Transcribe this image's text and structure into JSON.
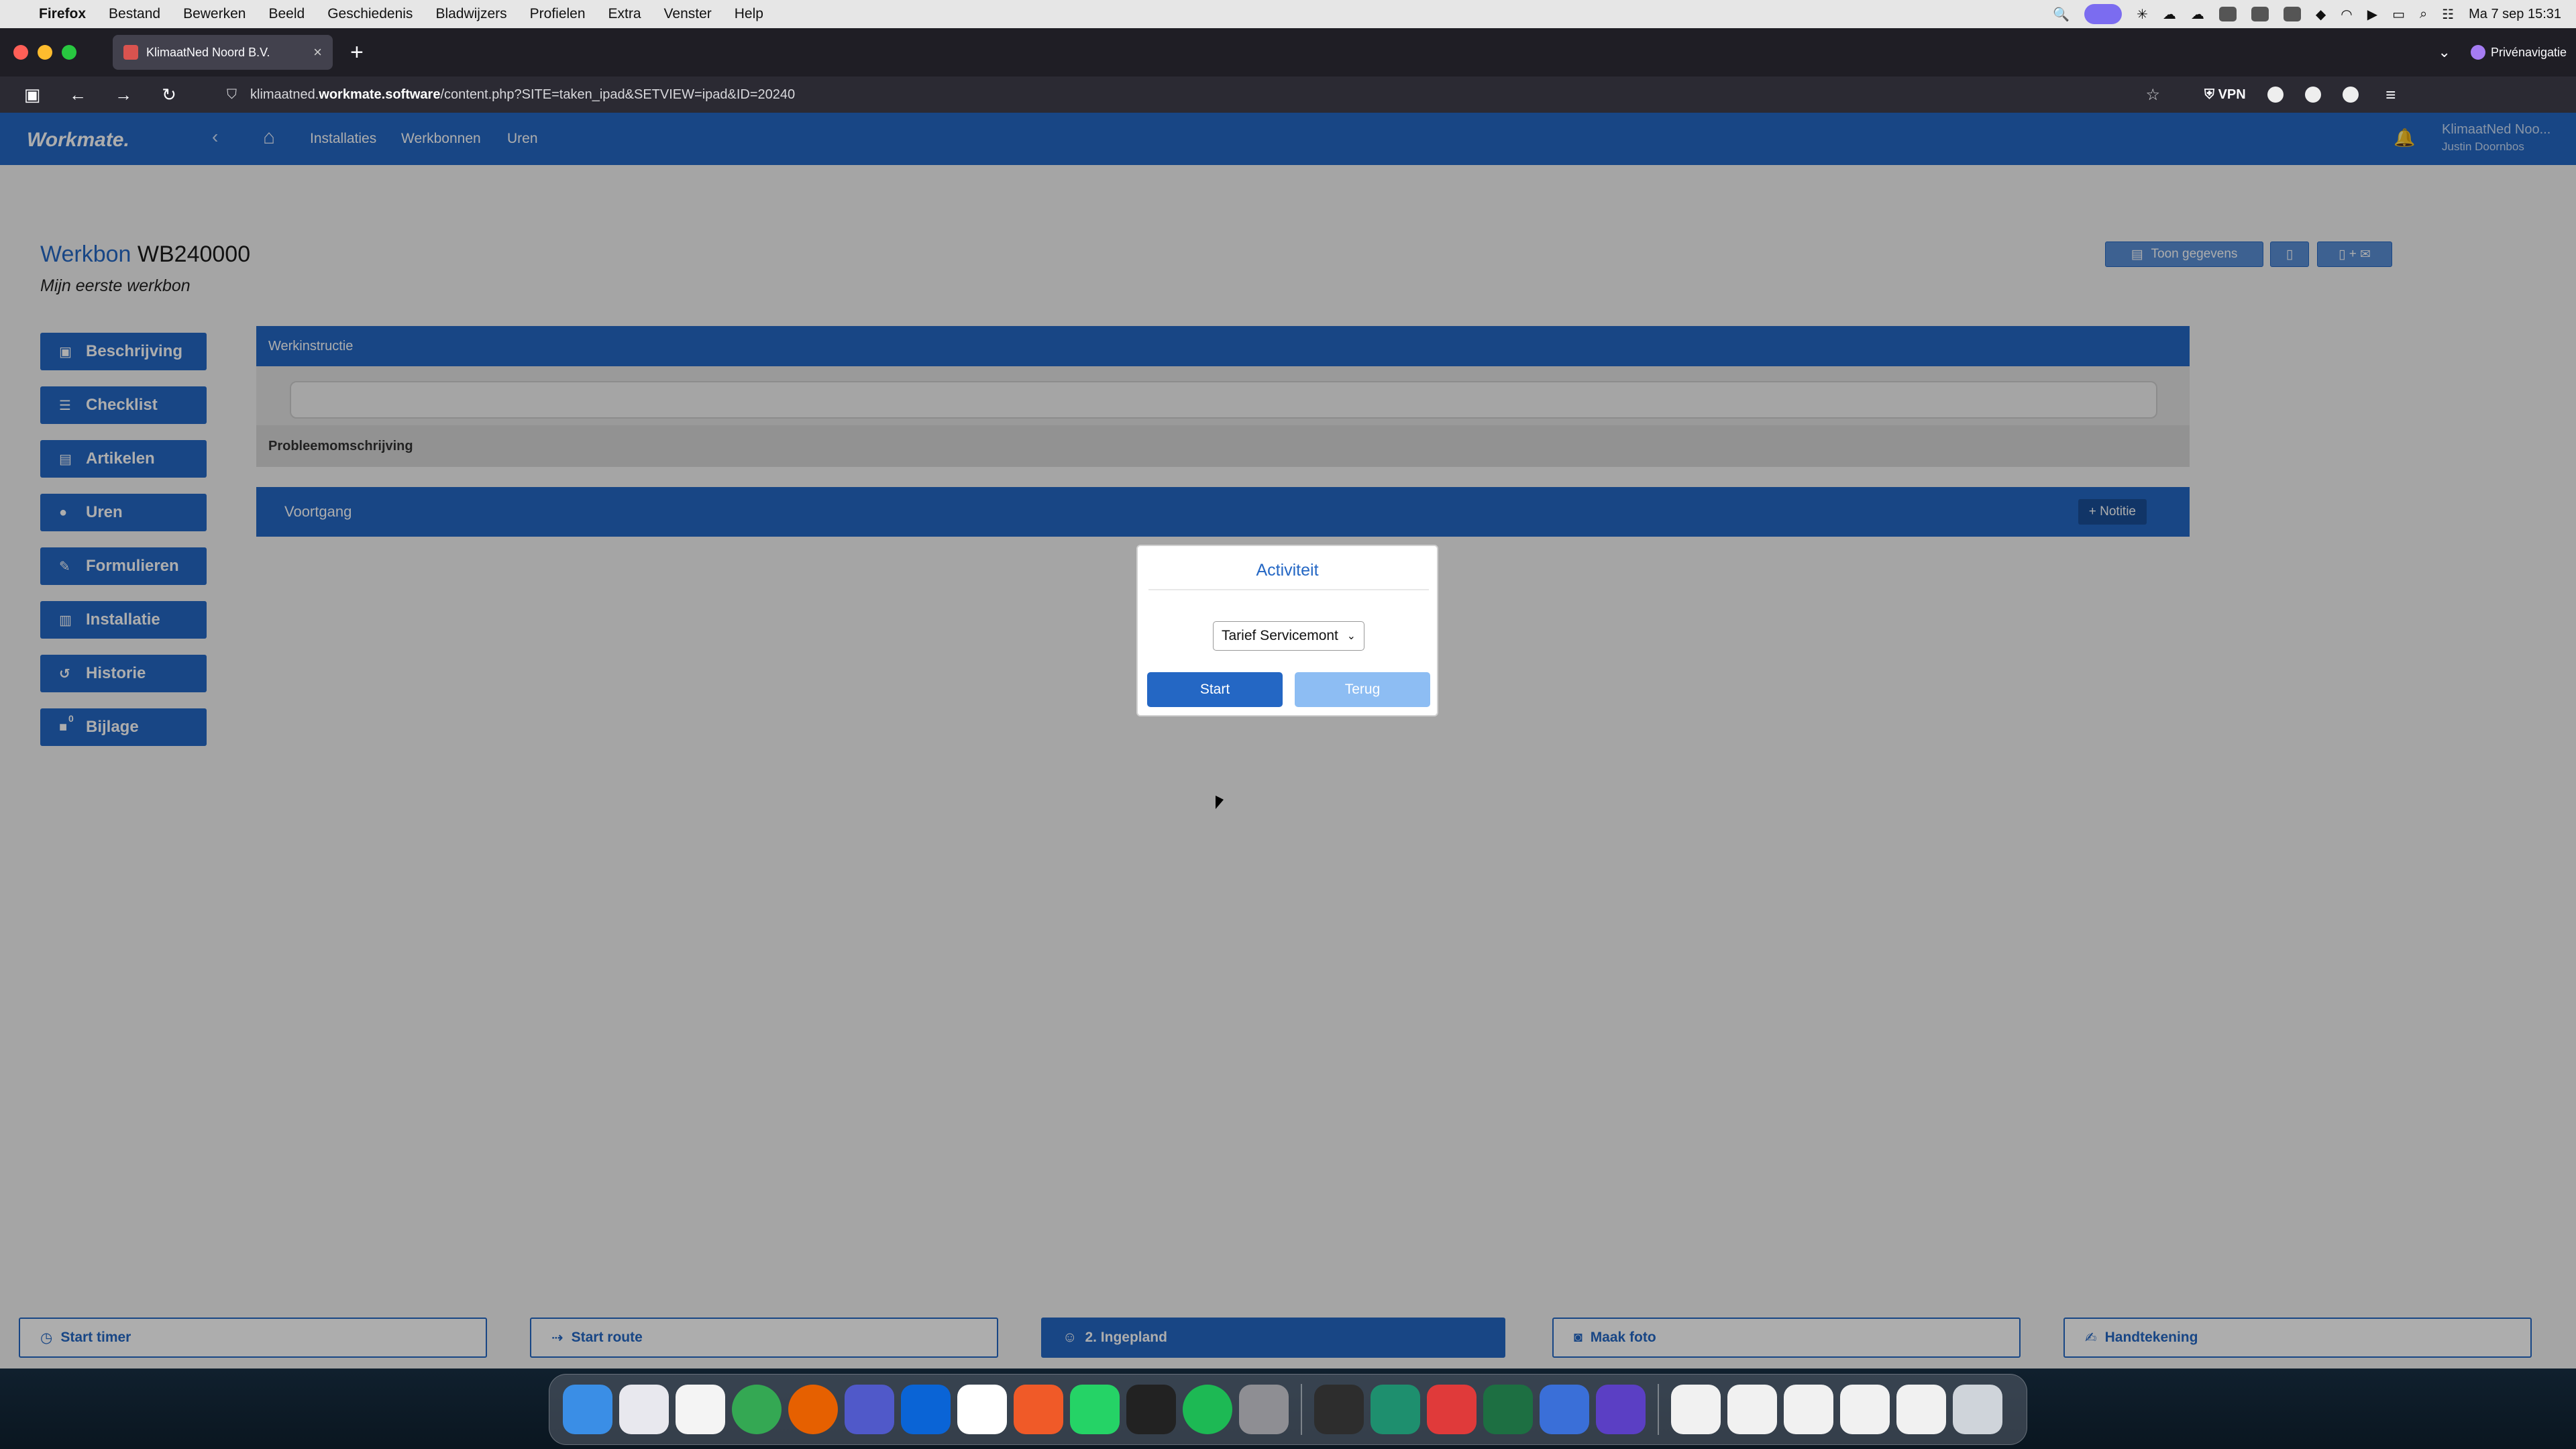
{
  "menubar": {
    "app": "Firefox",
    "items": [
      "Bestand",
      "Bewerken",
      "Beeld",
      "Geschiedenis",
      "Bladwijzers",
      "Profielen",
      "Extra",
      "Venster",
      "Help"
    ],
    "clock": "Ma 7 sep  15:31"
  },
  "browser": {
    "tab_title": "KlimaatNed Noord B.V.",
    "url_prefix": "klimaatned.",
    "url_domain": "workmate.software",
    "url_path": "/content.php?SITE=taken_ipad&SETVIEW=ipad&ID=20240",
    "vpn_label": "VPN",
    "private_label": "Privénavigatie"
  },
  "app": {
    "logo": "Workmate.",
    "nav": [
      "Installaties",
      "Werkbonnen",
      "Uren"
    ],
    "user_company": "KlimaatNed Noo...",
    "user_name": "Justin Doornbos"
  },
  "page": {
    "title_label": "Werkbon",
    "title_code": "WB240000",
    "subtitle": "Mijn eerste werkbon",
    "toon_gegevens": "Toon gegevens",
    "pdf_mail_label": "+"
  },
  "sidebar": [
    {
      "label": "Beschrijving",
      "icon": "▣"
    },
    {
      "label": "Checklist",
      "icon": "☰"
    },
    {
      "label": "Artikelen",
      "icon": "▤"
    },
    {
      "label": "Uren",
      "icon": "●"
    },
    {
      "label": "Formulieren",
      "icon": "✎"
    },
    {
      "label": "Installatie",
      "icon": "▥"
    },
    {
      "label": "Historie",
      "icon": "↺"
    },
    {
      "label": "Bijlage",
      "icon": "■",
      "badge": "0"
    }
  ],
  "sections": {
    "werkinstructie": "Werkinstructie",
    "probleem": "Probleemomschrijving",
    "voortgang": "Voortgang",
    "notitie": "+ Notitie"
  },
  "bottom": {
    "start_timer": "Start timer",
    "start_route": "Start route",
    "ingepland": "2. Ingepland",
    "maak_foto": "Maak foto",
    "handtekening": "Handtekening"
  },
  "modal": {
    "title": "Activiteit",
    "selected": "Tarief Servicemont",
    "start": "Start",
    "back": "Terug"
  },
  "colors": {
    "brand_blue": "#2467c4",
    "light_blue": "#8dbdf3"
  }
}
